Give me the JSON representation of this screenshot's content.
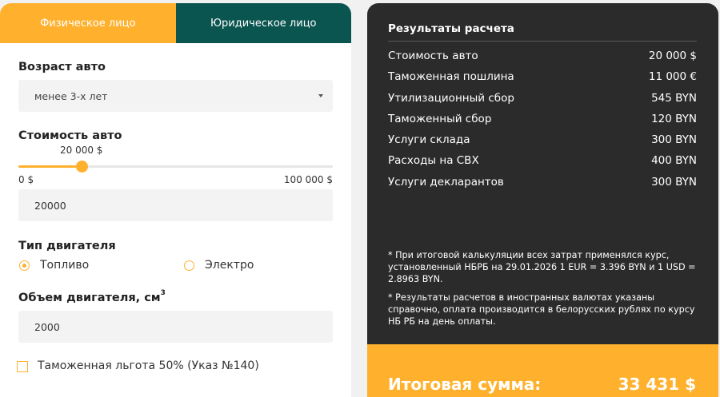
{
  "tabs": [
    {
      "label": "Физическое лицо",
      "active": true
    },
    {
      "label": "Юридическое лицо",
      "active": false
    }
  ],
  "form": {
    "age_label": "Возраст авто",
    "age_value": "менее 3-х лет",
    "cost_label": "Стоимость авто",
    "slider_value_label": "20 000 $",
    "slider_fraction": 0.2,
    "slider_min": "0 $",
    "slider_max": "100 000 $",
    "cost_input": "20000",
    "engine_type_label": "Тип двигателя",
    "engine_options": [
      {
        "label": "Топливо",
        "checked": true
      },
      {
        "label": "Электро",
        "checked": false
      }
    ],
    "volume_label": "Объем двигателя, см",
    "volume_sup": "3",
    "volume_input": "2000",
    "benefit_label": "Таможенная льгота 50% (Указ №140)",
    "benefit_checked": false
  },
  "results": {
    "title": "Результаты расчета",
    "rows": [
      {
        "label": "Стоимость авто",
        "value": "20 000 $"
      },
      {
        "label": "Таможенная пошлина",
        "value": "11 000 €"
      },
      {
        "label": "Утилизационный сбор",
        "value": "545 BYN"
      },
      {
        "label": "Таможенный сбор",
        "value": "120 BYN"
      },
      {
        "label": "Услуги склада",
        "value": "300 BYN"
      },
      {
        "label": "Расходы на СВХ",
        "value": "400 BYN"
      },
      {
        "label": "Услуги декларантов",
        "value": "300 BYN"
      }
    ],
    "note1": "* При итоговой калькуляции всех затрат применялся курс, установленный НБРБ на 29.01.2026 1 EUR = 3.396 BYN и 1 USD = 2.8963 BYN.",
    "note2": "* Результаты расчетов в иностранных валютах указаны справочно, оплата производится в белорусских рублях по курсу НБ РБ на день оплаты.",
    "total_label": "Итоговая сумма:",
    "total_value": "33 431 $"
  },
  "colors": {
    "accent": "#ffb12e",
    "tab_inactive": "#0b5550",
    "panel_dark": "#2b2b2b"
  }
}
